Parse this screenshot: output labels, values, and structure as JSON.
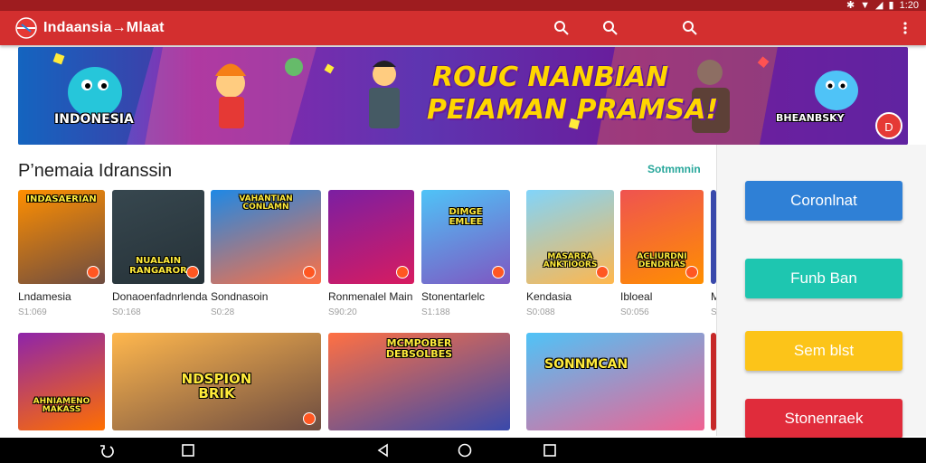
{
  "status_bar": {
    "time": "1:20",
    "icons": [
      "bluetooth-icon",
      "wifi-icon",
      "signal-icon",
      "battery-icon"
    ]
  },
  "app_bar": {
    "title": "Indaansia→Mlaat",
    "actions": [
      "search-icon",
      "search-icon",
      "search-icon",
      "more-vert-icon"
    ],
    "color": "#d32f2f"
  },
  "banner": {
    "headline_1": "ROUC NANBIAN",
    "headline_2": "PEIAMAN PRAMSA!",
    "left_label": "INDONESIA",
    "right_label": "BHEANBSKY",
    "badge": "D"
  },
  "section": {
    "title": "P’nemaia Idranssin",
    "see_all": "Sotmmnin"
  },
  "games_row_1": [
    {
      "title": "Lndamesia",
      "size": "S1:069",
      "art_label": "INDASAERIAN"
    },
    {
      "title": "Donaoenfadnrlenda",
      "size": "S0:168",
      "art_label": "NUALAIN\nRANGAROR"
    },
    {
      "title": "Sondnasoin",
      "size": "S0:28",
      "art_label": "VAHANTIAN\nCONLAMN"
    },
    {
      "title": "Ronmenalel Main",
      "size": "S90:20",
      "art_label": ""
    },
    {
      "title": "Stonentarlelc",
      "size": "S1:188",
      "art_label": "DIMGE\nEMLEE"
    },
    {
      "title": "Kendasia",
      "size": "S0:088",
      "art_label": "MASARRA\nANKTIOORS"
    },
    {
      "title": "Ibloeal",
      "size": "S0:056",
      "art_label": "ACLIURDNI\nDENDRIAS"
    },
    {
      "title": "M",
      "size": "S",
      "art_label": ""
    }
  ],
  "games_row_2": [
    {
      "title": "",
      "size": "",
      "art_label": "AHNIAMENO\nMAKASS"
    },
    {
      "title": "",
      "size": "",
      "art_label": "NDSPION\nBRIK"
    },
    {
      "title": "",
      "size": "",
      "art_label": "MCMPOBER\nDEBSOLBES"
    },
    {
      "title": "",
      "size": "",
      "art_label": "SONNMCAN"
    }
  ],
  "sidebar_buttons": [
    {
      "label": "Coronlnat",
      "color": "#2f80d6"
    },
    {
      "label": "Funb Ban",
      "color": "#1ec6b0"
    },
    {
      "label": "Sem blst",
      "color": "#fcc419"
    },
    {
      "label": "Stonenraek",
      "color": "#e02c3b"
    }
  ],
  "nav_bar": [
    "back-icon",
    "recents-icon",
    "back-triangle-icon",
    "home-icon",
    "overview-icon"
  ]
}
